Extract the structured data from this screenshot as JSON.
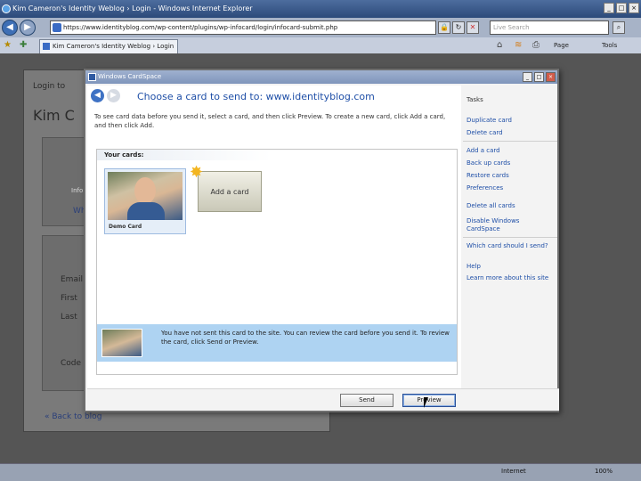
{
  "browser": {
    "title": "Kim Cameron's Identity Weblog › Login - Windows Internet Explorer",
    "url": "https://www.identityblog.com/wp-content/plugins/wp-infocard/login/infocard-submit.php",
    "search_placeholder": "Live Search",
    "tab_label": "Kim Cameron's Identity Weblog › Login",
    "cmd_page": "Page",
    "cmd_tools": "Tools",
    "status_zone": "Internet",
    "status_zoom": "100%",
    "window_buttons": [
      "_",
      "□",
      "×"
    ]
  },
  "page": {
    "login_to": "Login to",
    "site_title": "Kim C",
    "info_label": "Info",
    "what_label": "Wh",
    "fields": [
      "Email",
      "First",
      "Last"
    ],
    "code_label": "Code",
    "back_link": "« Back to blog"
  },
  "dialog": {
    "title": "Windows CardSpace",
    "heading": "Choose a card to send to: www.identityblog.com",
    "instructions": "To see card data before you send it, select a card, and then click Preview. To create a new card, click Add a card, and then click Add.",
    "your_cards": "Your cards:",
    "cards": [
      {
        "name": "Demo Card"
      }
    ],
    "add_card": "Add a card",
    "info_text": "You have not sent this card to the site. You can review the card before you send it. To review the card, click Send or Preview.",
    "tasks_title": "Tasks",
    "tasks_group1": [
      "Duplicate card",
      "Delete card"
    ],
    "tasks_group2": [
      "Add a card",
      "Back up cards",
      "Restore cards",
      "Preferences"
    ],
    "tasks_group3": [
      "Delete all cards",
      "Disable Windows CardSpace"
    ],
    "tasks_group4": [
      "Which card should I send?",
      "Help",
      "Learn more about this site"
    ],
    "send_label": "Send",
    "preview_label": "Preview"
  }
}
